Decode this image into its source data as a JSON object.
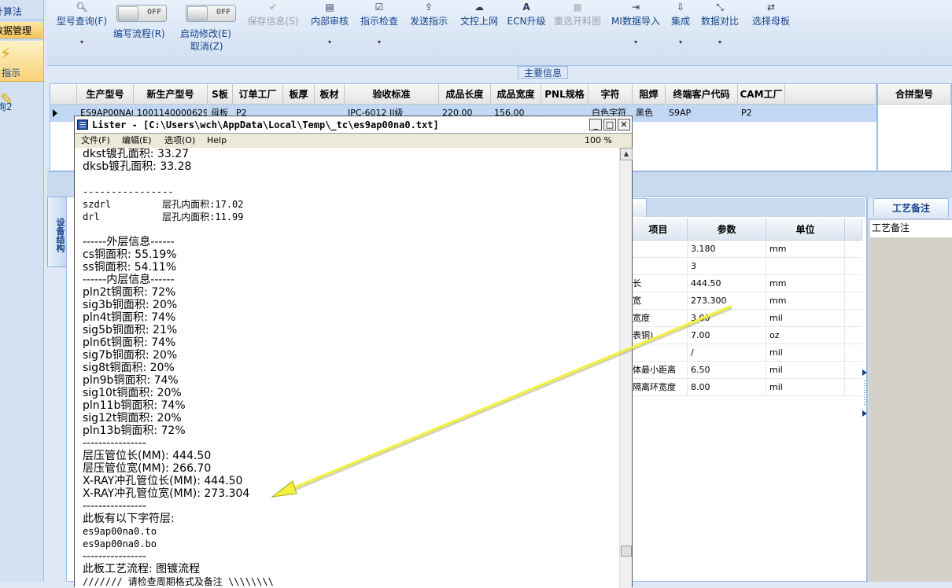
{
  "left_nav": {
    "item_top": "计算法",
    "item_active": "数据管理",
    "big1_label": "指示",
    "big2_label": "询2"
  },
  "toolbar": {
    "buttons": [
      {
        "icon": "search-icon",
        "label": "型号查询(F)",
        "dropdown": true,
        "enabled": true
      },
      {
        "icon": "toggle",
        "label": "编写流程(R)",
        "toggle_text": "OFF"
      },
      {
        "icon": "toggle",
        "label": "启动修改(E)",
        "label2": "取消(Z)",
        "toggle_text": "OFF"
      },
      {
        "icon": "check-icon",
        "label": "保存信息(S)",
        "enabled": false
      },
      {
        "icon": "print-icon",
        "label": "内部审核",
        "dropdown": true
      },
      {
        "icon": "check-square-icon",
        "label": "指示检查",
        "dropdown": true
      },
      {
        "icon": "upload-icon",
        "label": "发送指示"
      },
      {
        "icon": "cloud-upload-icon",
        "label": "文控上网"
      },
      {
        "icon": "letter-a-icon",
        "label": "ECN升级"
      },
      {
        "icon": "image-icon",
        "label": "重选开料图",
        "enabled": false
      },
      {
        "icon": "import-icon",
        "label": "MI数据导入",
        "dropdown": true
      },
      {
        "icon": "download-icon",
        "label": "集成",
        "dropdown": true
      },
      {
        "icon": "compress-icon",
        "label": "数据对比",
        "dropdown": true
      },
      {
        "icon": "shuffle-icon",
        "label": "选择母板"
      }
    ],
    "dropdown_glyph": "▾",
    "toggle_off": "OFF"
  },
  "main_info": {
    "title": "主要信息",
    "columns": [
      "生产型号",
      "新生产型号",
      "S板",
      "订单工厂",
      "板厚",
      "板材",
      "验收标准",
      "成品长度",
      "成品宽度",
      "PNL规格",
      "字符",
      "阻焊",
      "终端客户代码",
      "CAM工厂"
    ],
    "row": [
      "ES9AP00NA0",
      "10011400006299",
      "母板",
      "P2",
      "",
      "",
      "IPC-6012 II级",
      "220.00",
      "156.00",
      "",
      "白色字符",
      "黑色",
      "S9AP",
      "P2"
    ],
    "merge_header": "合拼型号"
  },
  "side_tab": {
    "label": "设备结构"
  },
  "param_table": {
    "headers": [
      "项目",
      "参数",
      "单位"
    ],
    "rows": [
      {
        "item": "",
        "value": "3.180",
        "unit": "mm"
      },
      {
        "item": "",
        "value": "3",
        "unit": ""
      },
      {
        "item": "长",
        "value": "444.50",
        "unit": "mm"
      },
      {
        "item": "宽",
        "value": "273.300",
        "unit": "mm"
      },
      {
        "item": "宽度",
        "value": "3.00",
        "unit": "mil"
      },
      {
        "item": "表铜)",
        "value": "7.00",
        "unit": "oz"
      },
      {
        "item": "",
        "value": "/",
        "unit": "mil"
      },
      {
        "item": "体最小距离",
        "value": "6.50",
        "unit": "mil"
      },
      {
        "item": "隔离环宽度",
        "value": "8.00",
        "unit": "mil"
      }
    ]
  },
  "right_panel": {
    "tab": "工艺备注",
    "caption": "工艺备注"
  },
  "lister": {
    "title": "Lister - [C:\\Users\\wch\\AppData\\Local\\Temp\\_tc\\es9ap00na0.txt]",
    "minimize": "_",
    "maximize": "□",
    "close": "✕",
    "menu": [
      "文件(F)",
      "编辑(E)",
      "选项(O)",
      "Help"
    ],
    "zoom": "100 %",
    "lines": [
      "dkst镀孔面积: 33.27",
      "dksb镀孔面积: 33.28",
      "",
      "----------------",
      "szdrl         层孔内面积:17.02",
      "drl           层孔内面积:11.99",
      "",
      "------外层信息------",
      "cs铜面积: 55.19%",
      "ss铜面积: 54.11%",
      "------内层信息------",
      "pln2t铜面积: 72%",
      "sig3b铜面积: 20%",
      "pln4t铜面积: 74%",
      "sig5b铜面积: 21%",
      "pln6t铜面积: 74%",
      "sig7b铜面积: 20%",
      "sig8t铜面积: 20%",
      "pln9b铜面积: 74%",
      "sig10t铜面积: 20%",
      "pln11b铜面积: 74%",
      "sig12t铜面积: 20%",
      "pln13b铜面积: 72%",
      "----------------",
      "层压管位长(MM): 444.50",
      "层压管位宽(MM): 266.70",
      "X-RAY冲孔管位长(MM): 444.50",
      "X-RAY冲孔管位宽(MM): 273.304",
      "----------------",
      "此板有以下字符层:",
      "es9ap00na0.to",
      "es9ap00na0.bo",
      "----------------",
      "此板工艺流程: 图镀流程",
      "/////// 请检查周期格式及备注 \\\\\\\\\\\\\\\\"
    ]
  },
  "colors": {
    "accent": "#15428b",
    "selected_row": "#c1d8f5",
    "annotation_arrow": "#f2f23a"
  }
}
